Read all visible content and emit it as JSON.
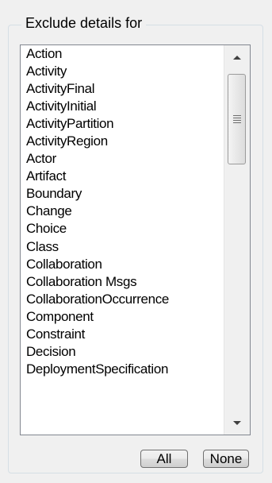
{
  "group": {
    "title": "Exclude details for"
  },
  "list": {
    "items": [
      "Action",
      "Activity",
      "ActivityFinal",
      "ActivityInitial",
      "ActivityPartition",
      "ActivityRegion",
      "Actor",
      "Artifact",
      "Boundary",
      "Change",
      "Choice",
      "Class",
      "Collaboration",
      "Collaboration Msgs",
      "CollaborationOccurrence",
      "Component",
      "Constraint",
      "Decision",
      "DeploymentSpecification"
    ]
  },
  "buttons": {
    "all_label": "All",
    "none_label": "None"
  },
  "icons": {
    "scroll_up": "scroll-up-arrow-icon",
    "scroll_down": "scroll-down-arrow-icon",
    "thumb_grip": "grip-icon"
  },
  "colors": {
    "background": "#f0f0f0",
    "listbox_bg": "#ffffff",
    "listbox_border": "#828790",
    "groupbox_border": "#d5dfe5"
  }
}
